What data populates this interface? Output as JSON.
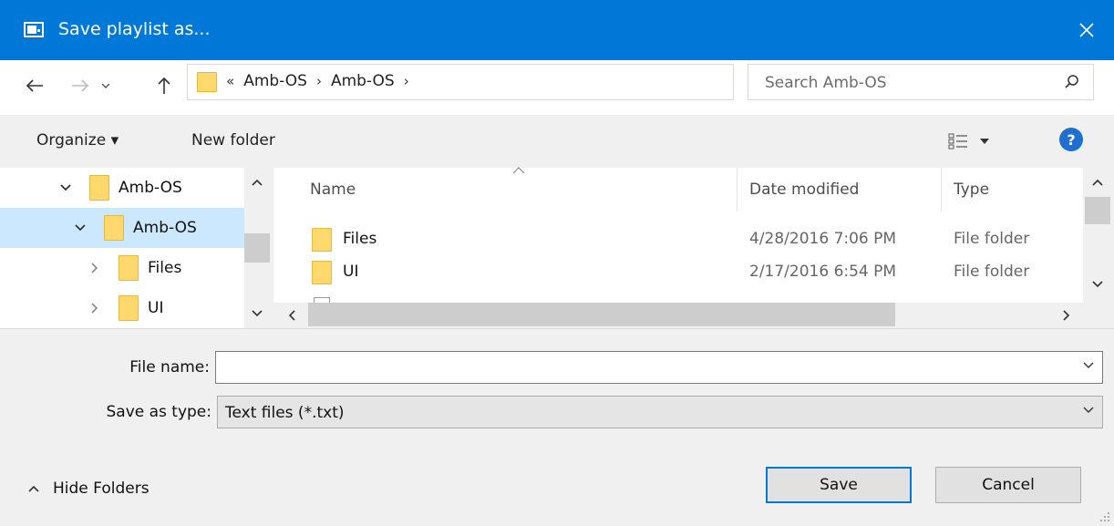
{
  "window": {
    "title": "Save playlist as...",
    "accent_color": "#0078d7"
  },
  "navigation": {
    "back_icon": "arrow-left-icon",
    "forward_icon": "arrow-right-icon",
    "recent_icon": "chevron-down-icon",
    "up_icon": "arrow-up-icon",
    "breadcrumb_overflow": "«",
    "breadcrumbs": [
      "Amb-OS",
      "Amb-OS"
    ],
    "search_placeholder": "Search Amb-OS"
  },
  "toolbar": {
    "organize_label": "Organize ▾",
    "new_folder_label": "New folder",
    "help_label": "?"
  },
  "tree": {
    "items": [
      {
        "label": "Amb-OS",
        "expanded": true,
        "selected": false
      },
      {
        "label": "Amb-OS",
        "expanded": true,
        "selected": true
      },
      {
        "label": "Files",
        "expanded": false,
        "selected": false
      },
      {
        "label": "UI",
        "expanded": false,
        "selected": false
      }
    ]
  },
  "files": {
    "columns": [
      "Name",
      "Date modified",
      "Type"
    ],
    "rows": [
      {
        "name": "Files",
        "date": "4/28/2016 7:06 PM",
        "type": "File folder"
      },
      {
        "name": "UI",
        "date": "2/17/2016 6:54 PM",
        "type": "File folder"
      }
    ]
  },
  "form": {
    "file_name_label": "File name:",
    "file_name_value": "",
    "save_type_label": "Save as type:",
    "save_type_value": "Text files (*.txt)"
  },
  "footer": {
    "hide_folders_label": "Hide Folders",
    "save_label": "Save",
    "cancel_label": "Cancel"
  }
}
